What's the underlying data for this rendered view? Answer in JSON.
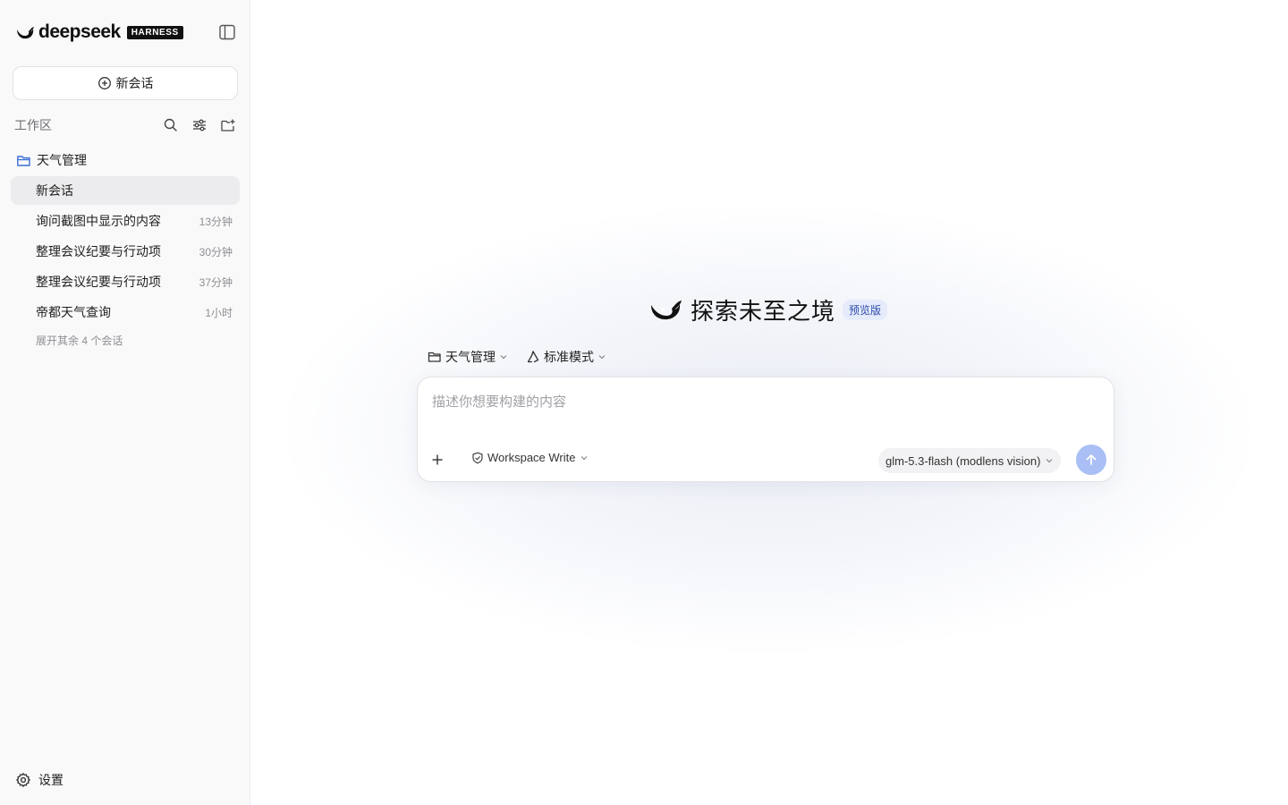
{
  "brand": {
    "name": "deepseek",
    "badge": "HARNESS"
  },
  "sidebar": {
    "new_chat_label": "新会话",
    "workspace_label": "工作区",
    "project": {
      "name": "天气管理"
    },
    "conversations": [
      {
        "title": "新会话",
        "time": "",
        "active": true
      },
      {
        "title": "询问截图中显示的内容",
        "time": "13分钟",
        "active": false
      },
      {
        "title": "整理会议纪要与行动项",
        "time": "30分钟",
        "active": false
      },
      {
        "title": "整理会议纪要与行动项",
        "time": "37分钟",
        "active": false
      },
      {
        "title": "帝都天气查询",
        "time": "1小时",
        "active": false
      }
    ],
    "expand_more": "展开其余 4 个会话",
    "settings_label": "设置"
  },
  "main": {
    "hero_title": "探索未至之境",
    "hero_badge": "预览版",
    "project_selector": "天气管理",
    "mode_selector": "标准模式",
    "composer": {
      "placeholder": "描述你想要构建的内容",
      "permission": "Workspace Write",
      "model": "glm-5.3-flash (modlens vision)"
    }
  },
  "icons": {
    "collapse": "sidebar-toggle-icon",
    "new_chat": "plus-circle-icon",
    "search": "search-icon",
    "filter": "sliders-icon",
    "new_folder": "folder-plus-icon",
    "folder": "folder-icon",
    "settings": "gear-icon",
    "attach": "plus-icon",
    "permission": "shield-check-icon",
    "mode": "recycle-icon",
    "send": "arrow-up-icon"
  },
  "colors": {
    "accent": "#a9bff5",
    "badge_bg": "#e5ebfb",
    "badge_text": "#2d4aa8",
    "folder": "#3d6fd6"
  }
}
